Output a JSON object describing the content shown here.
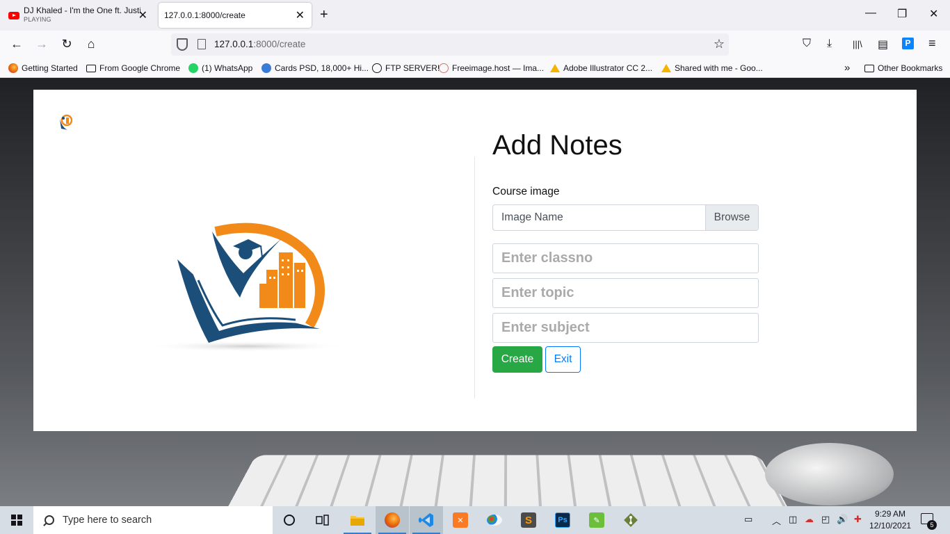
{
  "browser": {
    "tabs": [
      {
        "title": "DJ Khaled - I'm the One ft. Justin",
        "subtitle": "PLAYING",
        "close": "✕"
      },
      {
        "title": "127.0.0.1:8000/create",
        "close": "✕"
      }
    ],
    "new_tab": "+",
    "window_controls": {
      "minimize": "—",
      "maximize": "❐",
      "close": "✕"
    },
    "nav": {
      "back": "←",
      "forward": "→",
      "reload": "↻",
      "home": "⌂"
    },
    "url": {
      "host": "127.0.0.1",
      "rest": ":8000/create"
    },
    "bookmark_star": "☆",
    "toolbar_icons": [
      "pocket-icon",
      "download-icon",
      "library-icon",
      "sidebar-icon",
      "extension-icon",
      "menu-icon"
    ],
    "toolbar_glyphs": {
      "pocket": "⛉",
      "download": "⤓",
      "library": "|||\\",
      "sidebar": "▤",
      "extension": "P",
      "menu": "≡"
    },
    "bookmarks": [
      {
        "label": "Getting Started",
        "icon": "firefox-icon"
      },
      {
        "label": "From Google Chrome",
        "icon": "folder-icon"
      },
      {
        "label": "(1) WhatsApp",
        "icon": "whatsapp-icon"
      },
      {
        "label": "Cards PSD, 18,000+ Hi...",
        "icon": "freepik-icon"
      },
      {
        "label": "FTP SERVER!",
        "icon": "globe-icon"
      },
      {
        "label": "Freeimage.host — Ima...",
        "icon": "freeimage-icon"
      },
      {
        "label": "Adobe Illustrator CC 2...",
        "icon": "drive-icon"
      },
      {
        "label": "Shared with me - Goo...",
        "icon": "drive-icon"
      }
    ],
    "bookmarks_overflow": "»",
    "other_bookmarks": "Other Bookmarks"
  },
  "page": {
    "title": "Add Notes",
    "course_image_label": "Course image",
    "file_placeholder": "Image Name",
    "browse_label": "Browse",
    "classno_placeholder": "Enter classno",
    "topic_placeholder": "Enter topic",
    "subject_placeholder": "Enter subject",
    "create_label": "Create",
    "exit_label": "Exit",
    "colors": {
      "create": "#28a745",
      "exit": "#007bff",
      "logo_blue": "#1b4f7a",
      "logo_orange": "#f28a1a"
    }
  },
  "taskbar": {
    "search_placeholder": "Type here to search",
    "apps": [
      "task-view-icon",
      "file-explorer-icon",
      "firefox-icon",
      "vscode-icon",
      "xampp-icon",
      "paint-icon",
      "sublime-icon",
      "photoshop-icon",
      "notepad-icon",
      "git-icon"
    ],
    "photoshop_glyph": "Ps",
    "time": "9:29 AM",
    "date": "12/10/2021",
    "notification_count": "5"
  }
}
